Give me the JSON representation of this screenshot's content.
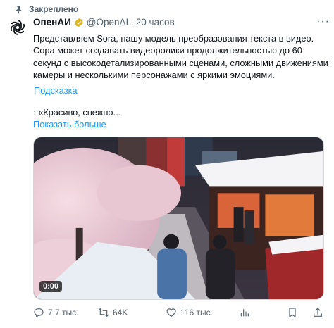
{
  "pinned": {
    "label": "Закреплено",
    "icon": "pin-icon"
  },
  "tweet": {
    "author_name": "ОпенАИ",
    "handle": "@OpenAI",
    "separator": "·",
    "time": "20 часов",
    "text": "Представляем Sora, нашу модель преобразования текста в видео. Сора может создавать видеоролики продолжительностью до 60 секунд с высокодетализированными сценами, сложными движениями камеры и несколькими персонажами с яркими эмоциями.",
    "hint_link": "Подсказка",
    "quote_text": ": «Красиво, снежно...",
    "show_more": "Показать больше",
    "more_icon": "···"
  },
  "media": {
    "video_time": "0:00"
  },
  "actions": {
    "replies": "7,7 тыс.",
    "retweets": "64K",
    "likes": "116 тыс."
  },
  "colors": {
    "accent": "#1d9bf0",
    "secondary_text": "#536471",
    "verified_gold": "#e2b719"
  }
}
